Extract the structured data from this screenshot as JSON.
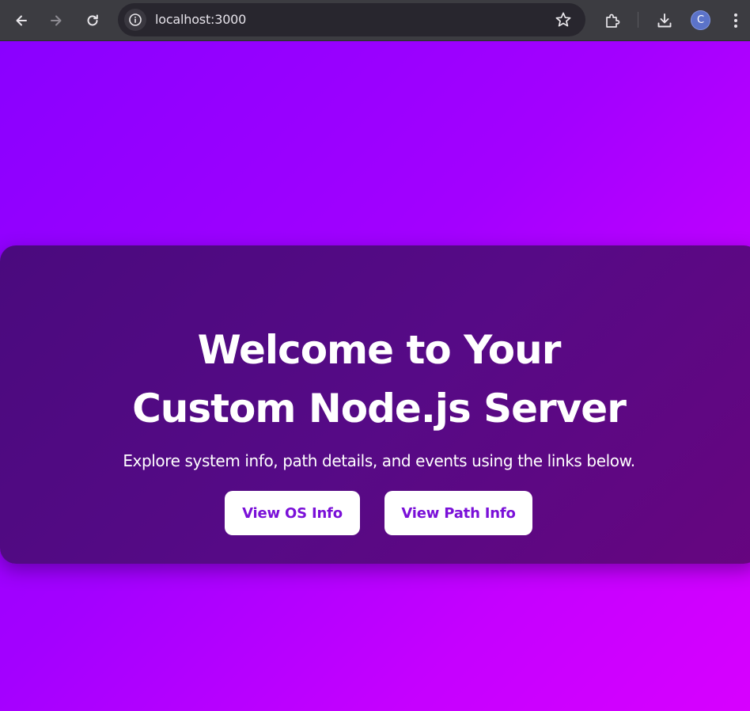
{
  "browser": {
    "url": "localhost:3000",
    "profile_initial": "C",
    "icons": {
      "back": "arrow-left-icon",
      "forward": "arrow-right-icon",
      "reload": "reload-icon",
      "site_info": "info-icon",
      "bookmark": "star-icon",
      "extensions": "puzzle-icon",
      "downloads": "download-icon",
      "menu": "kebab-menu-icon"
    }
  },
  "hero": {
    "title_line1": "Welcome to Your",
    "title_line2": "Custom Node.js Server",
    "subtitle": "Explore system info, path details, and events using the links below.",
    "buttons": {
      "os_info": "View OS Info",
      "path_info": "View Path Info"
    }
  },
  "colors": {
    "page_gradient_start": "#8a00ff",
    "page_gradient_end": "#d700ff",
    "card_background": "#560a86",
    "button_text": "#7a10d8",
    "browser_toolbar": "#3c3c41"
  }
}
